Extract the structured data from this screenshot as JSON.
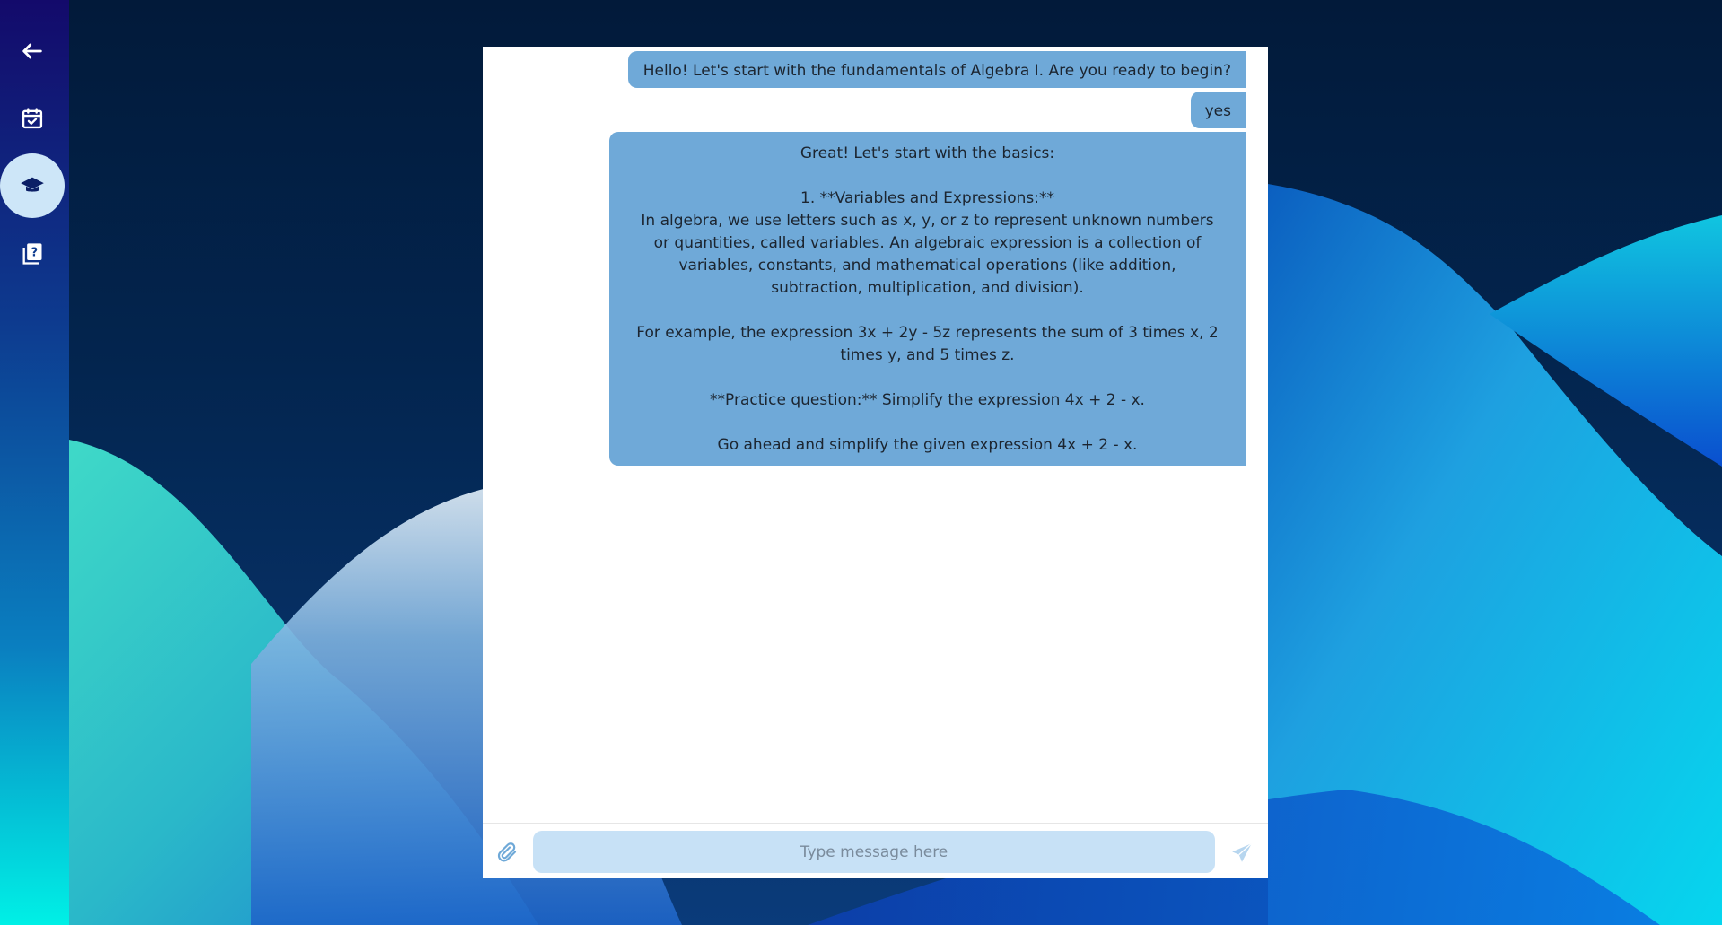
{
  "sidebar": {
    "items": [
      {
        "icon": "back-arrow-icon"
      },
      {
        "icon": "calendar-check-icon"
      },
      {
        "icon": "graduation-cap-icon",
        "active": true
      },
      {
        "icon": "question-book-icon"
      }
    ]
  },
  "chat": {
    "messages": [
      {
        "text": "Hello! Let's start with the fundamentals of Algebra I. Are you ready to begin?"
      },
      {
        "text": "yes"
      },
      {
        "text": "Great! Let's start with the basics:\n\n1. **Variables and Expressions:**\n   In algebra, we use letters such as x, y, or z to represent unknown numbers or quantities, called variables. An algebraic expression is a collection of variables, constants, and mathematical operations (like addition, subtraction, multiplication, and division).\n\n   For example, the expression 3x + 2y - 5z represents the sum of 3 times x, 2 times y, and 5 times z.\n\n**Practice question:** Simplify the expression 4x + 2 - x.\n\nGo ahead and simplify the given expression 4x + 2 - x."
      }
    ],
    "input": {
      "placeholder": "Type message here",
      "value": ""
    }
  },
  "colors": {
    "bubble": "#6fa9d8",
    "input_bg": "#c7e1f6",
    "active_sidebar": "#cde6f8"
  }
}
